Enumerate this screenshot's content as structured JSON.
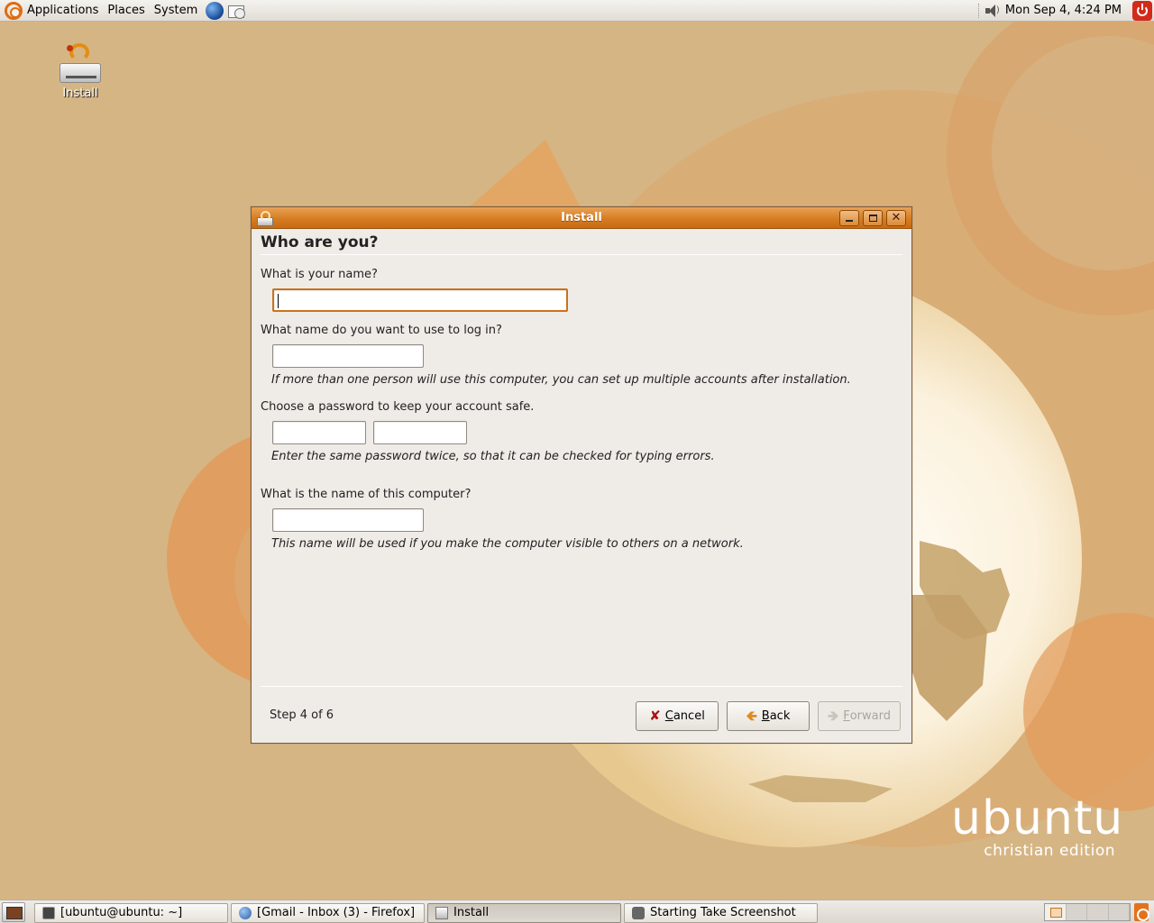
{
  "top_panel": {
    "menus": [
      "Applications",
      "Places",
      "System"
    ],
    "clock": "Mon Sep  4,  4:24 PM"
  },
  "desktop": {
    "install_icon_label": "Install",
    "brand_word": "ubuntu",
    "brand_edition": "christian edition"
  },
  "window": {
    "title": "Install",
    "heading": "Who are you?",
    "name_question": "What is your name?",
    "name_value": "",
    "login_question": "What name do you want to use to log in?",
    "login_value": "",
    "login_note": "If more than one person will use this computer, you can set up multiple accounts after installation.",
    "password_question": "Choose a password to keep your account safe.",
    "password_value": "",
    "password_confirm_value": "",
    "password_note": "Enter the same password twice, so that it can be checked for typing errors.",
    "computer_question": "What is the name of this computer?",
    "computer_value": "",
    "computer_note": "This name will be used if you make the computer visible to others on a network.",
    "step": "Step 4 of 6",
    "buttons": {
      "cancel": {
        "mnemonic": "C",
        "rest": "ancel"
      },
      "back": {
        "mnemonic": "B",
        "rest": "ack"
      },
      "forward": {
        "mnemonic": "F",
        "rest": "orward"
      }
    }
  },
  "taskbar": {
    "tasks": [
      "[ubuntu@ubuntu: ~]",
      "[Gmail - Inbox (3) - Firefox]",
      "Install",
      "Starting Take Screenshot"
    ],
    "active_task": "Install"
  },
  "colors": {
    "wallpaper": "#d6b584",
    "titlebar": "#d67c22",
    "focus_border": "#c8731c"
  }
}
